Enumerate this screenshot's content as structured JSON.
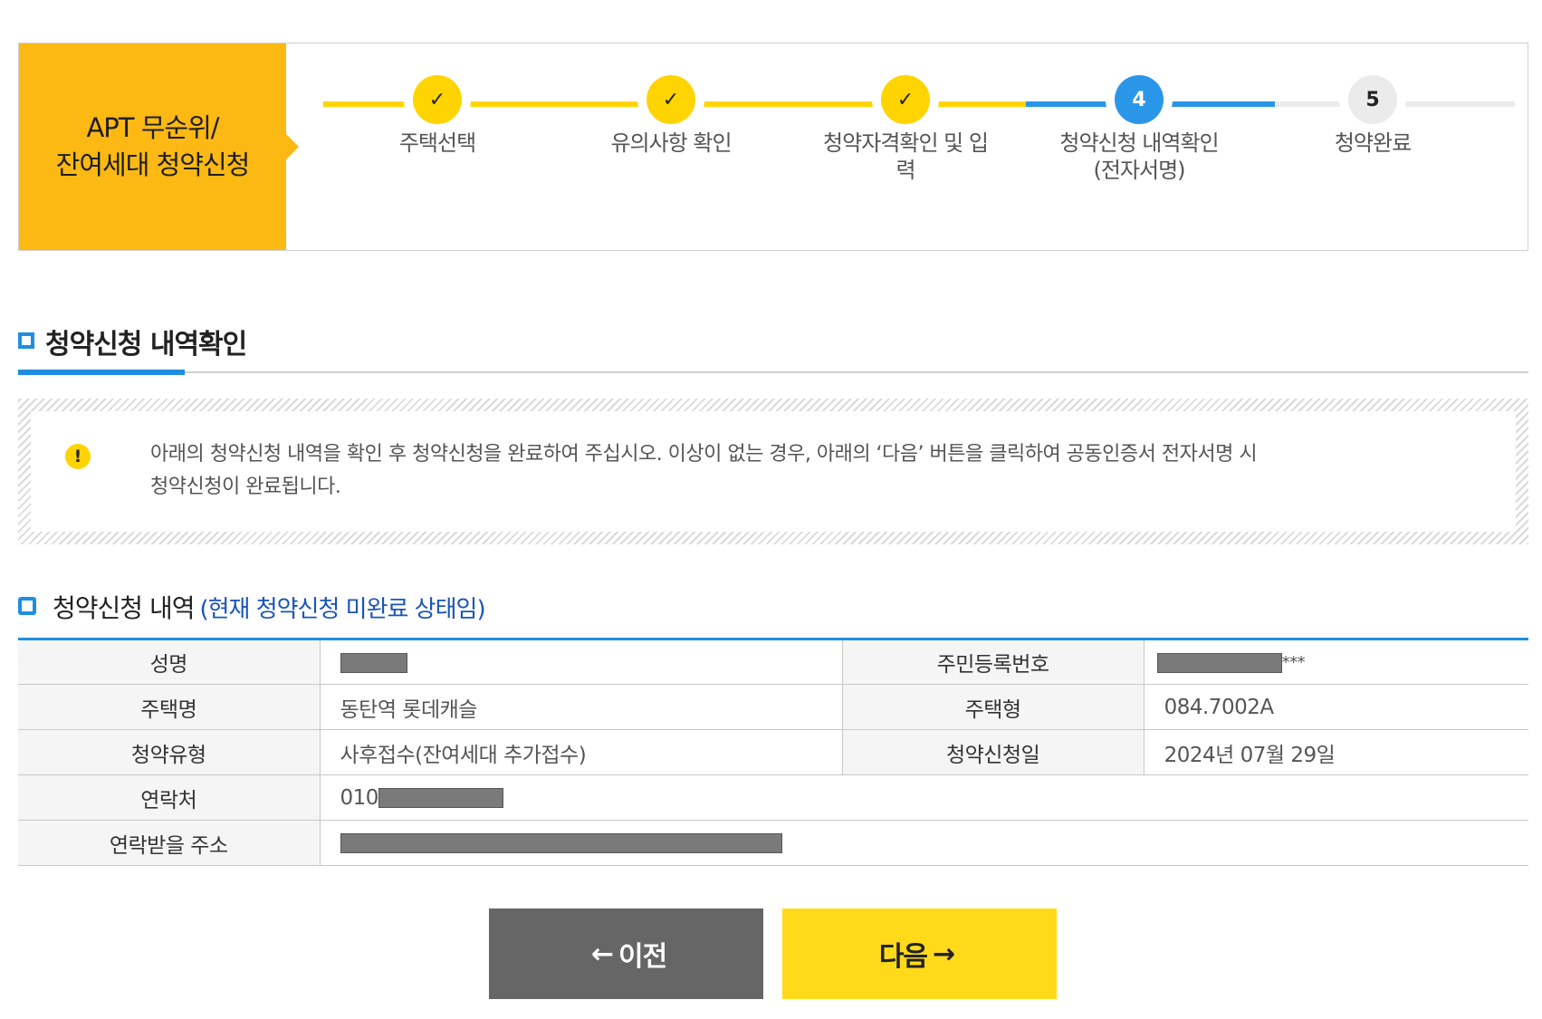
{
  "header": {
    "title_line1": "APT 무순위/",
    "title_line2": "잔여세대 청약신청"
  },
  "steps": [
    {
      "label": "주택선택",
      "status": "done",
      "marker": "✓"
    },
    {
      "label": "유의사항 확인",
      "status": "done",
      "marker": "✓"
    },
    {
      "label": "청약자격확인 및 입력",
      "status": "done",
      "marker": "✓"
    },
    {
      "label": "청약신청 내역확인 (전자서명)",
      "status": "current",
      "marker": "4"
    },
    {
      "label": "청약완료",
      "status": "pending",
      "marker": "5"
    }
  ],
  "colors": {
    "accent_yellow": "#fcb913",
    "step_done": "#ffd400",
    "step_current": "#2a96e8",
    "step_pending": "#ebebeb",
    "status_blue": "#1b54b8",
    "prev_button": "#666666",
    "next_button": "#ffda1a"
  },
  "section": {
    "title": "청약신청 내역확인"
  },
  "notice": {
    "icon": "exclamation-icon",
    "icon_glyph": "!",
    "text_line1": "아래의 청약신청 내역을 확인 후 청약신청을 완료하여 주십시오. 이상이 없는 경우, 아래의 ‘다음’ 버튼을 클릭하여 공동인증서 전자서명 시",
    "text_line2": "청약신청이 완료됩니다."
  },
  "details": {
    "title": "청약신청 내역",
    "status": "(현재 청약신청 미완료 상태임)",
    "name_label": "성명",
    "id_label": "주민등록번호",
    "id_suffix": "***",
    "house_name_label": "주택명",
    "house_name": "동탄역 롯데캐슬",
    "house_type_label": "주택형",
    "house_type": "084.7002A",
    "apply_type_label": "청약유형",
    "apply_type": "사후접수(잔여세대 추가접수)",
    "apply_date_label": "청약신청일",
    "apply_date": "2024년 07월 29일",
    "phone_label": "연락처",
    "phone_prefix": "010",
    "address_label": "연락받을 주소"
  },
  "buttons": {
    "prev_arrow": "←",
    "prev_label": "이전",
    "next_label": "다음",
    "next_arrow": "→"
  }
}
